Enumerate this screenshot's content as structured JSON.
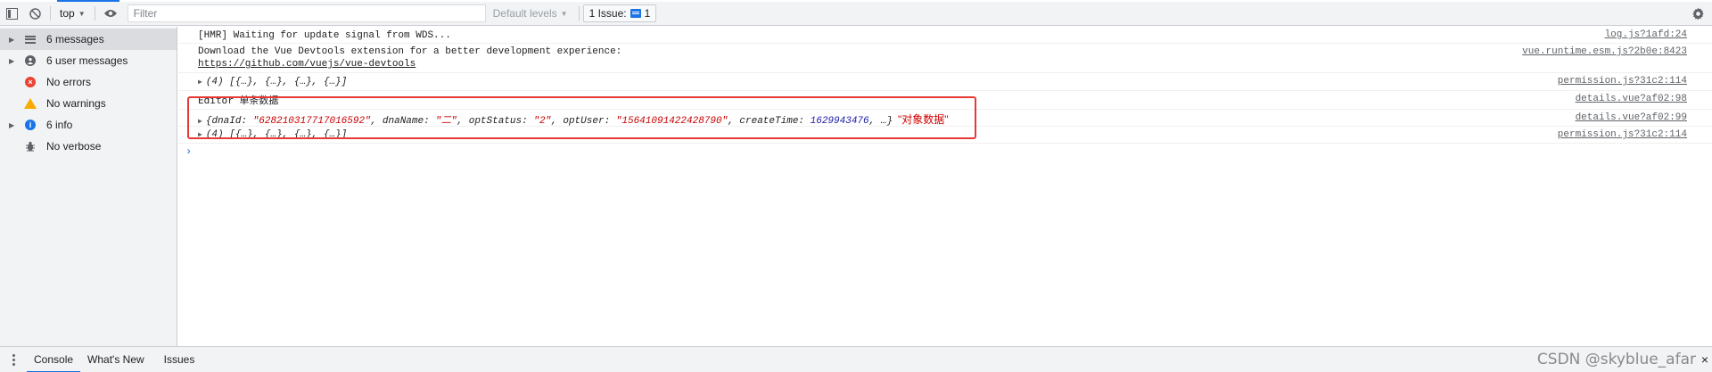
{
  "toolbar": {
    "context": "top",
    "filter_placeholder": "Filter",
    "levels_label": "Default levels",
    "issues_label": "1 Issue:",
    "issues_count": "1"
  },
  "sidebar": {
    "items": [
      {
        "label": "6 messages",
        "icon": "list-icon",
        "expandable": true,
        "selected": true
      },
      {
        "label": "6 user messages",
        "icon": "user-icon",
        "expandable": true
      },
      {
        "label": "No errors",
        "icon": "error-icon",
        "expandable": false
      },
      {
        "label": "No warnings",
        "icon": "warning-icon",
        "expandable": false
      },
      {
        "label": "6 info",
        "icon": "info-icon",
        "expandable": true
      },
      {
        "label": "No verbose",
        "icon": "bug-icon",
        "expandable": false
      }
    ]
  },
  "console": {
    "messages": [
      {
        "text": "[HMR] Waiting for update signal from WDS...",
        "source": "log.js?1afd:24"
      },
      {
        "text": "Download the Vue Devtools extension for a better development experience:",
        "link": "https://github.com/vuejs/vue-devtools",
        "source": "vue.runtime.esm.js?2b0e:8423"
      },
      {
        "text": "(4) [{…}, {…}, {…}, {…}]",
        "source": "permission.js?31c2:114"
      },
      {
        "text": "Editor 单条数据",
        "source": "details.vue?af02:98"
      },
      {
        "object": {
          "dnaId_key": "dnaId",
          "dnaId_val": "\"628210317717016592\"",
          "dnaName_key": "dnaName",
          "dnaName_val": "\"二\"",
          "optStatus_key": "optStatus",
          "optStatus_val": "\"2\"",
          "optUser_key": "optUser",
          "optUser_val": "\"15641091422428790\"",
          "createTime_key": "createTime",
          "createTime_val": "1629943476",
          "ellipsis": "…}"
        },
        "annotation": "\"对象数据\"",
        "source": "details.vue?af02:99"
      },
      {
        "text": "(4) [{…}, {…}, {…}, {…}]",
        "source": "permission.js?31c2:114"
      }
    ],
    "prompt": "›"
  },
  "drawer": {
    "tabs": [
      "Console",
      "What's New",
      "Issues"
    ],
    "watermark": "CSDN @skyblue_afar",
    "close": "×"
  },
  "colors": {
    "accent": "#1a73e8",
    "string": "#c80000",
    "number": "#1a1aa6",
    "annotation_border": "#e53935"
  }
}
